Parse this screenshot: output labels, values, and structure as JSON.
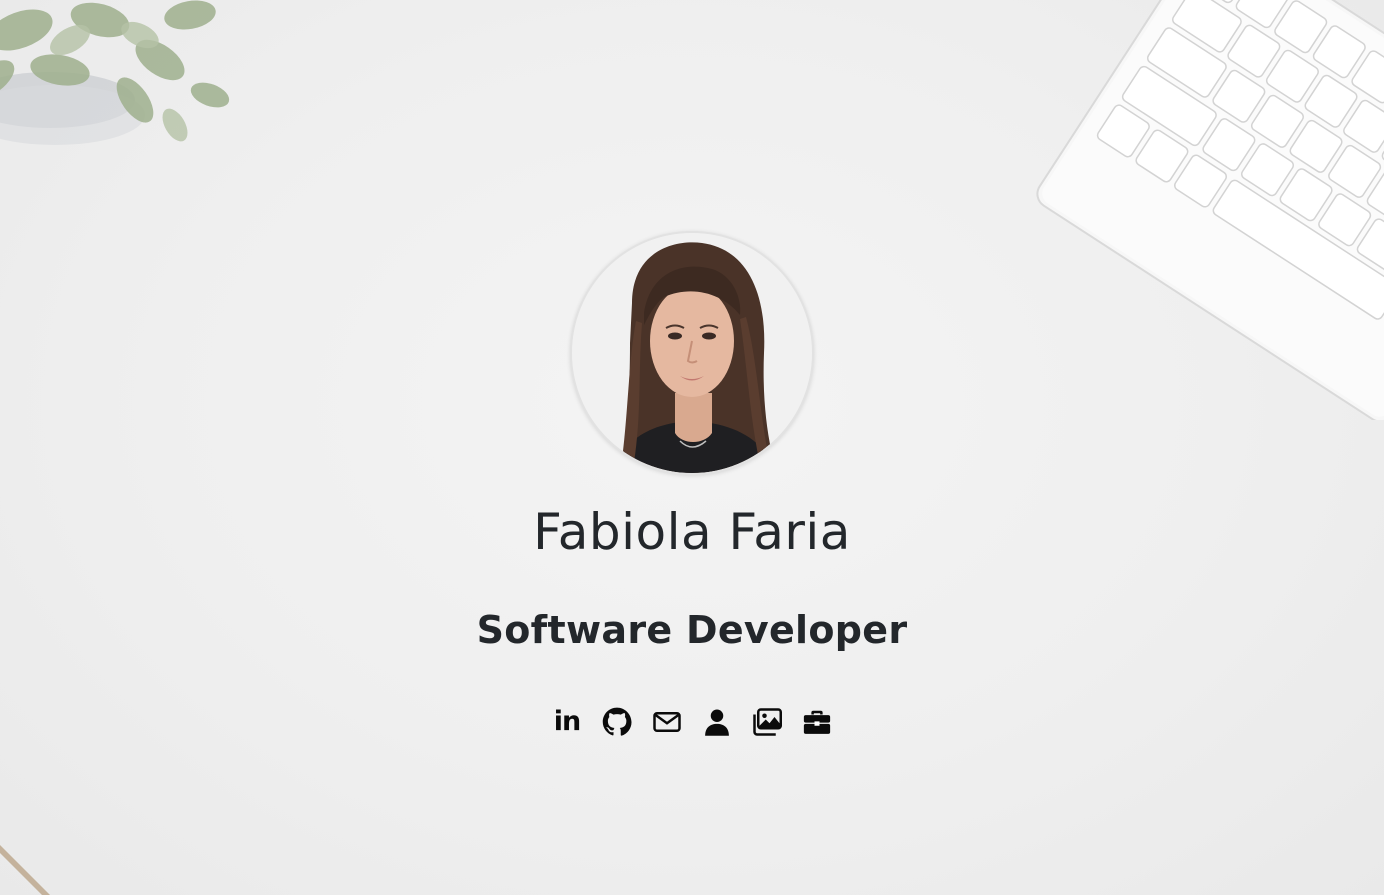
{
  "profile": {
    "name": "Fabiola Faria",
    "title": "Software Developer"
  },
  "social_links": [
    {
      "icon": "linkedin-icon",
      "text": "in"
    },
    {
      "icon": "github-icon"
    },
    {
      "icon": "email-icon"
    },
    {
      "icon": "user-icon"
    },
    {
      "icon": "gallery-icon"
    },
    {
      "icon": "briefcase-icon"
    }
  ],
  "colors": {
    "text": "#23272b",
    "icons": "#0b0b0b",
    "background": "#efefef"
  }
}
